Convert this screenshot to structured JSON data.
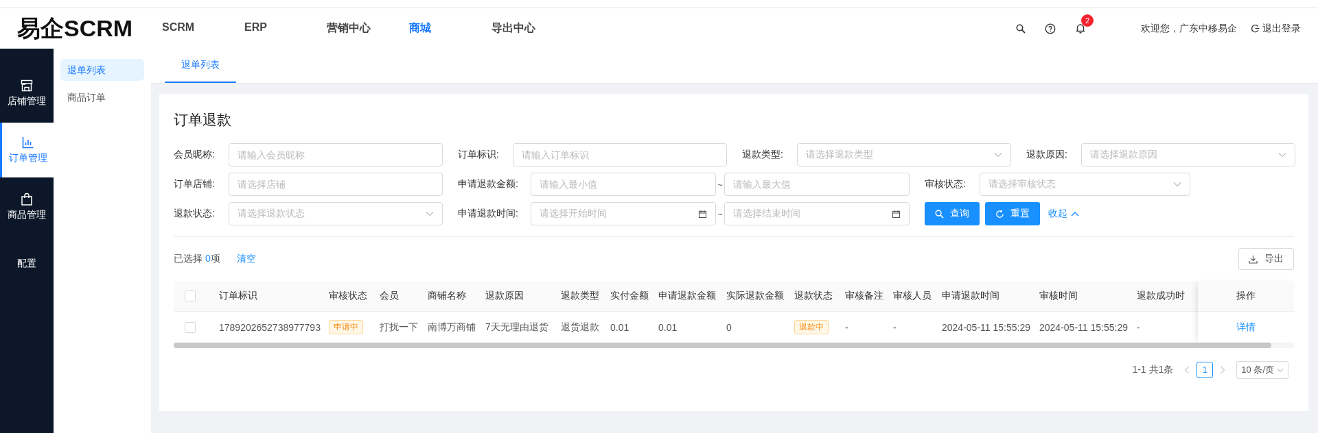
{
  "header": {
    "logo": "易企SCRM",
    "nav": [
      {
        "label": "SCRM",
        "selected": false
      },
      {
        "label": "ERP",
        "selected": false
      },
      {
        "label": "营销中心",
        "selected": false
      },
      {
        "label": "商城",
        "selected": true
      },
      {
        "label": "导出中心",
        "selected": false
      }
    ],
    "notification_badge": "2",
    "welcome": "欢迎您，广东中移易企",
    "logout": "退出登录"
  },
  "sidebar": {
    "items": [
      {
        "label": "店铺管理",
        "selected": false
      },
      {
        "label": "订单管理",
        "selected": true
      },
      {
        "label": "商品管理",
        "selected": false
      },
      {
        "label": "配置",
        "selected": false
      }
    ]
  },
  "subnav": {
    "items": [
      {
        "label": "退单列表",
        "selected": true
      },
      {
        "label": "商品订单",
        "selected": false
      }
    ]
  },
  "tabs": [
    {
      "label": "退单列表",
      "selected": true
    }
  ],
  "page_title": "订单退款",
  "filters": [
    [
      {
        "kind": "input",
        "label": "会员昵称:",
        "placeholder": "请输入会员昵称"
      },
      {
        "kind": "input",
        "label": "订单标识:",
        "placeholder": "请输入订单标识"
      },
      {
        "kind": "select",
        "label": "退款类型:",
        "placeholder": "请选择退款类型"
      },
      {
        "kind": "select",
        "label": "退款原因:",
        "placeholder": "请选择退款原因"
      }
    ],
    [
      {
        "kind": "input",
        "label": "订单店铺:",
        "placeholder": "请选择店铺"
      },
      {
        "kind": "range",
        "label": "申请退款金额:",
        "placeholder": "请输入最小值",
        "placeholder_end": "请输入最大值",
        "separator": "~"
      },
      {
        "kind": "select",
        "label": "审核状态:",
        "placeholder": "请选择审核状态"
      }
    ],
    [
      {
        "kind": "select",
        "label": "退款状态:",
        "placeholder": "请选择退款状态"
      },
      {
        "kind": "date-range",
        "label": "申请退款时间:",
        "placeholder": "请选择开始时间",
        "placeholder_end": "请选择结束时间",
        "separator": "~"
      }
    ]
  ],
  "actions": {
    "search": "查询",
    "reset": "重置",
    "collapse": "收起"
  },
  "selection": {
    "prefix": "已选择",
    "count": "0",
    "suffix": "项",
    "clear": "清空"
  },
  "export": "导出",
  "table": {
    "select_all": {
      "checked": false
    },
    "columns": [
      "订单标识",
      "审核状态",
      "会员",
      "商铺名称",
      "退款原因",
      "退款类型",
      "实付金额",
      "申请退款金额",
      "实际退款金额",
      "退款状态",
      "审核备注",
      "审核人员",
      "申请退款时间",
      "审核时间",
      "退款成功时",
      "操作"
    ],
    "rows": [
      {
        "checked": false,
        "cells": [
          {
            "kind": "text",
            "text": "1789202652738977793"
          },
          {
            "kind": "tag",
            "text": "申请中"
          },
          {
            "kind": "text",
            "text": "打扰一下"
          },
          {
            "kind": "text",
            "text": "南博万商铺"
          },
          {
            "kind": "text",
            "text": "7天无理由退货"
          },
          {
            "kind": "text",
            "text": "退货退款"
          },
          {
            "kind": "text",
            "text": "0.01"
          },
          {
            "kind": "text",
            "text": "0.01"
          },
          {
            "kind": "text",
            "text": "0"
          },
          {
            "kind": "tag",
            "text": "退款中"
          },
          {
            "kind": "text",
            "text": "-"
          },
          {
            "kind": "text",
            "text": "-"
          },
          {
            "kind": "text",
            "text": "2024-05-11 15:55:29"
          },
          {
            "kind": "text",
            "text": "2024-05-11 15:55:29"
          },
          {
            "kind": "text",
            "text": "-"
          },
          {
            "kind": "link",
            "text": "详情"
          }
        ]
      }
    ]
  },
  "pagination": {
    "total": "1-1 共1条",
    "pages": [
      {
        "label": "1",
        "selected": true
      }
    ],
    "page_size": "10 条/页"
  }
}
